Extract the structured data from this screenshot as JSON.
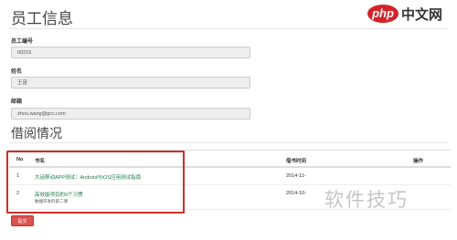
{
  "logo": {
    "badge": "php",
    "text": "中文网"
  },
  "employee": {
    "title": "员工信息",
    "id_label": "员工编号",
    "id_value": "00216",
    "name_label": "姓名",
    "name_value": "王宙",
    "email_label": "邮箱",
    "email_value": "zhou.wang@gcc.com"
  },
  "borrow": {
    "title": "借阅情况",
    "columns": {
      "no": "No",
      "book": "书名",
      "time": "借书时间",
      "action": "操作"
    },
    "rows": [
      {
        "no": "1",
        "book": "大话移动APP测试：Android与iOS应用测试指南",
        "time": "2014-11-",
        "extra": ""
      },
      {
        "no": "2",
        "book": "高效能项目的9个习惯",
        "extra": "敏捷开发的第二课",
        "time": "2014-10-"
      }
    ]
  },
  "action_button": "提交",
  "watermark": "软件技巧",
  "colors": {
    "accent": "#d9534f",
    "link": "#1e7a4a",
    "brand": "#d2232a"
  }
}
